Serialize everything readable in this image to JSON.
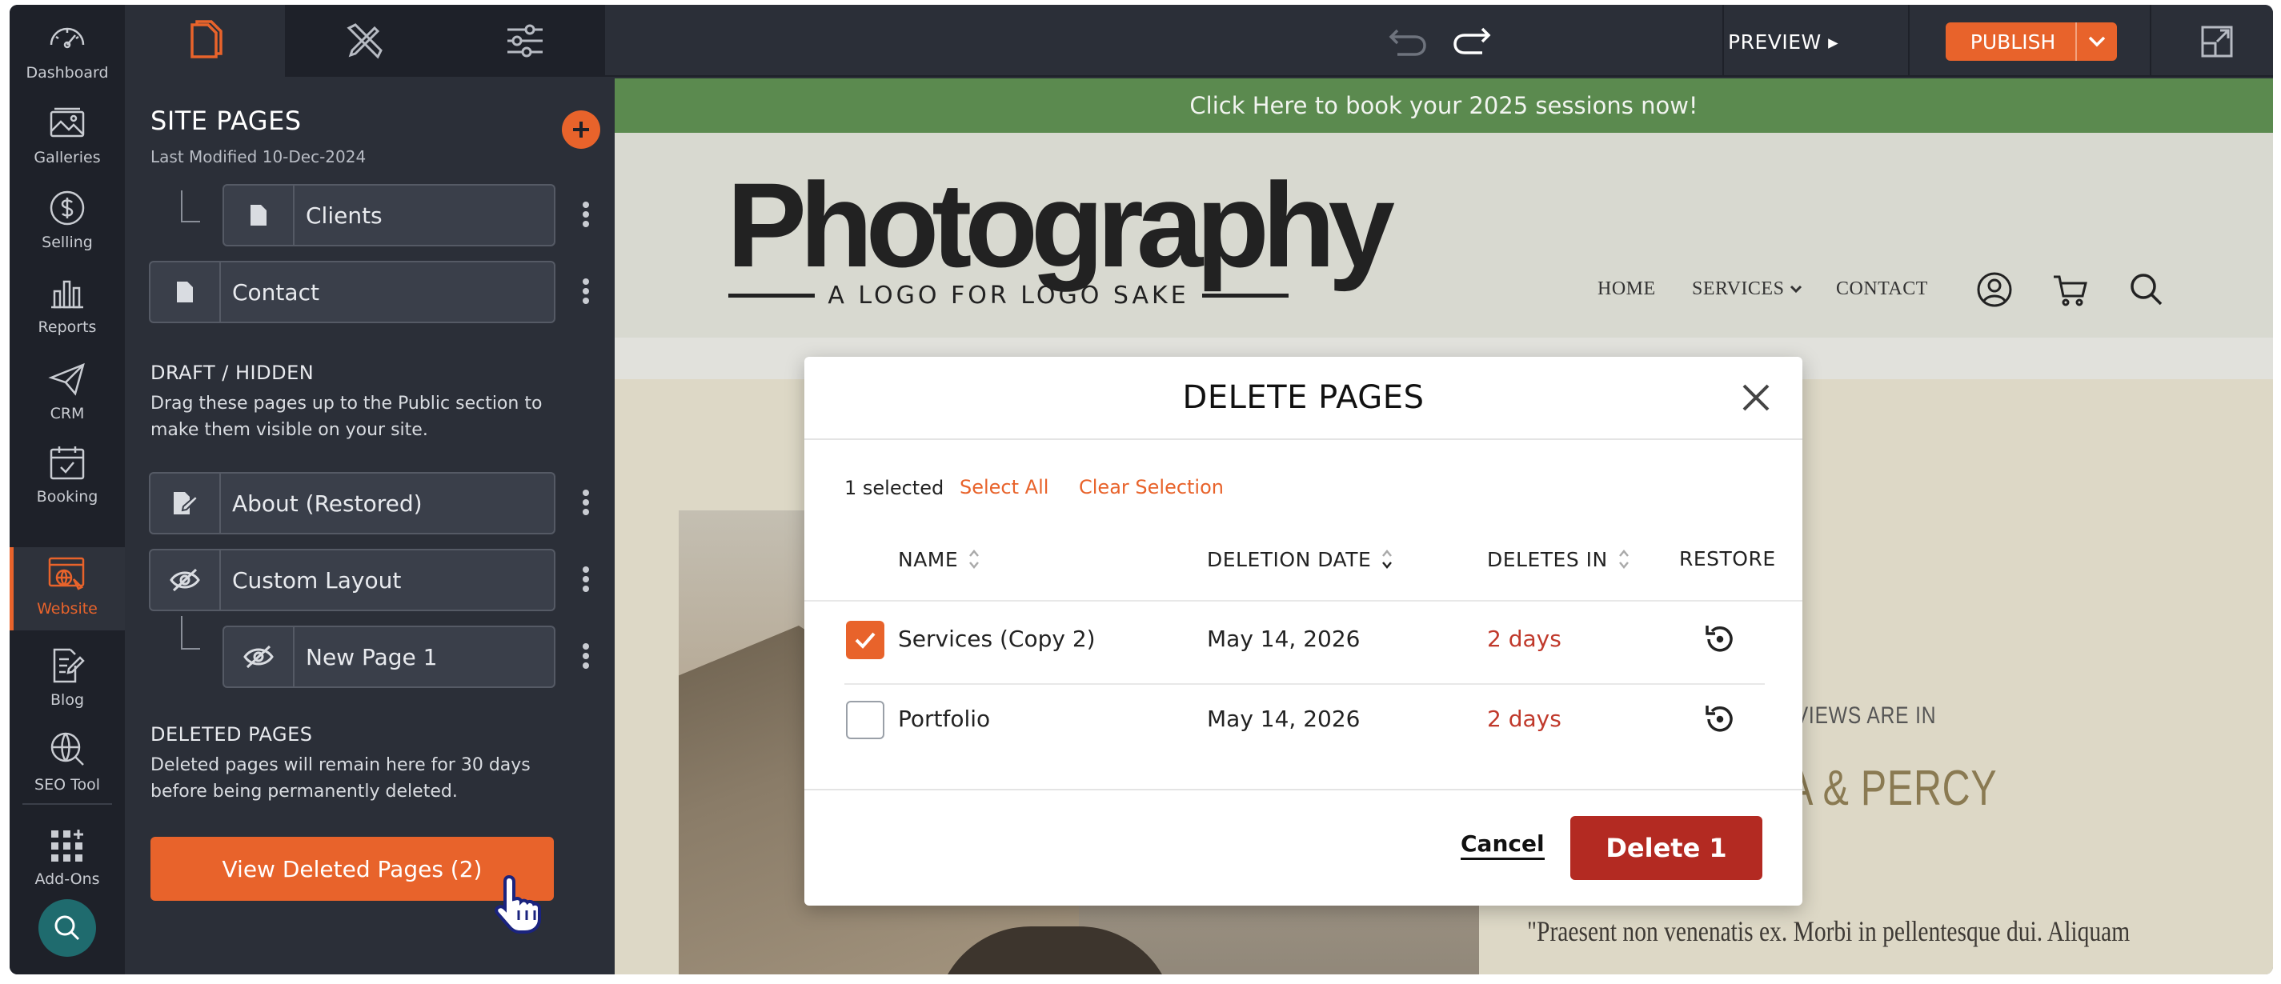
{
  "rail": {
    "items": [
      {
        "label": "Dashboard",
        "icon": "dashboard-gauge-icon"
      },
      {
        "label": "Galleries",
        "icon": "image-icon"
      },
      {
        "label": "Selling",
        "icon": "dollar-icon"
      },
      {
        "label": "Reports",
        "icon": "bar-chart-icon"
      },
      {
        "label": "CRM",
        "icon": "paper-plane-icon"
      },
      {
        "label": "Booking",
        "icon": "calendar-icon"
      },
      {
        "label": "Website",
        "icon": "website-globe-icon",
        "active": true
      },
      {
        "label": "Blog",
        "icon": "blog-edit-icon"
      },
      {
        "label": "SEO Tool",
        "icon": "seo-globe-icon"
      },
      {
        "label": "Add-Ons",
        "icon": "addons-grid-icon"
      }
    ]
  },
  "toolbar": {
    "preview_label": "PREVIEW ▸",
    "publish_label": "PUBLISH"
  },
  "panel": {
    "title": "SITE PAGES",
    "subtitle": "Last Modified 10-Dec-2024",
    "public_pages": [
      {
        "name": "Clients",
        "child": true
      },
      {
        "name": "Contact",
        "child": false
      }
    ],
    "draft_heading": "DRAFT / HIDDEN",
    "draft_text": "Drag these pages up to the Public section to make them visible on your site.",
    "draft_pages": [
      {
        "name": "About (Restored)",
        "child": false
      },
      {
        "name": "Custom Layout",
        "child": false
      },
      {
        "name": "New Page 1",
        "child": true
      }
    ],
    "deleted_heading": "DELETED PAGES",
    "deleted_text": "Deleted pages will remain here for 30 days before being permanently deleted.",
    "view_deleted_label": "View Deleted Pages (2)"
  },
  "site": {
    "banner": "Click Here to book your 2025 sessions now!",
    "logo_main": "Photography",
    "logo_sub": "A LOGO FOR LOGO SAKE",
    "nav": [
      "HOME",
      "SERVICES",
      "CONTACT"
    ],
    "reviews_kicker": "E REVIEWS ARE IN",
    "reviews_name": "MA & PERCY",
    "reviews_quote": "\"Praesent non venenatis ex. Morbi in pellentesque dui. Aliquam"
  },
  "modal": {
    "title": "DELETE PAGES",
    "selected_count": "1 selected",
    "select_all": "Select All",
    "clear_selection": "Clear Selection",
    "columns": [
      "NAME",
      "DELETION DATE",
      "DELETES IN",
      "RESTORE"
    ],
    "rows": [
      {
        "name": "Services (Copy 2)",
        "date": "May 14, 2026",
        "deletes_in": "2 days",
        "checked": true
      },
      {
        "name": "Portfolio",
        "date": "May 14, 2026",
        "deletes_in": "2 days",
        "checked": false
      }
    ],
    "cancel_label": "Cancel",
    "delete_label": "Delete 1"
  },
  "colors": {
    "accent": "#e8632b",
    "danger": "#b32a22",
    "banner": "#5b8a4f",
    "rail_bg": "#1e2129",
    "panel_bg": "#2b2f38"
  }
}
